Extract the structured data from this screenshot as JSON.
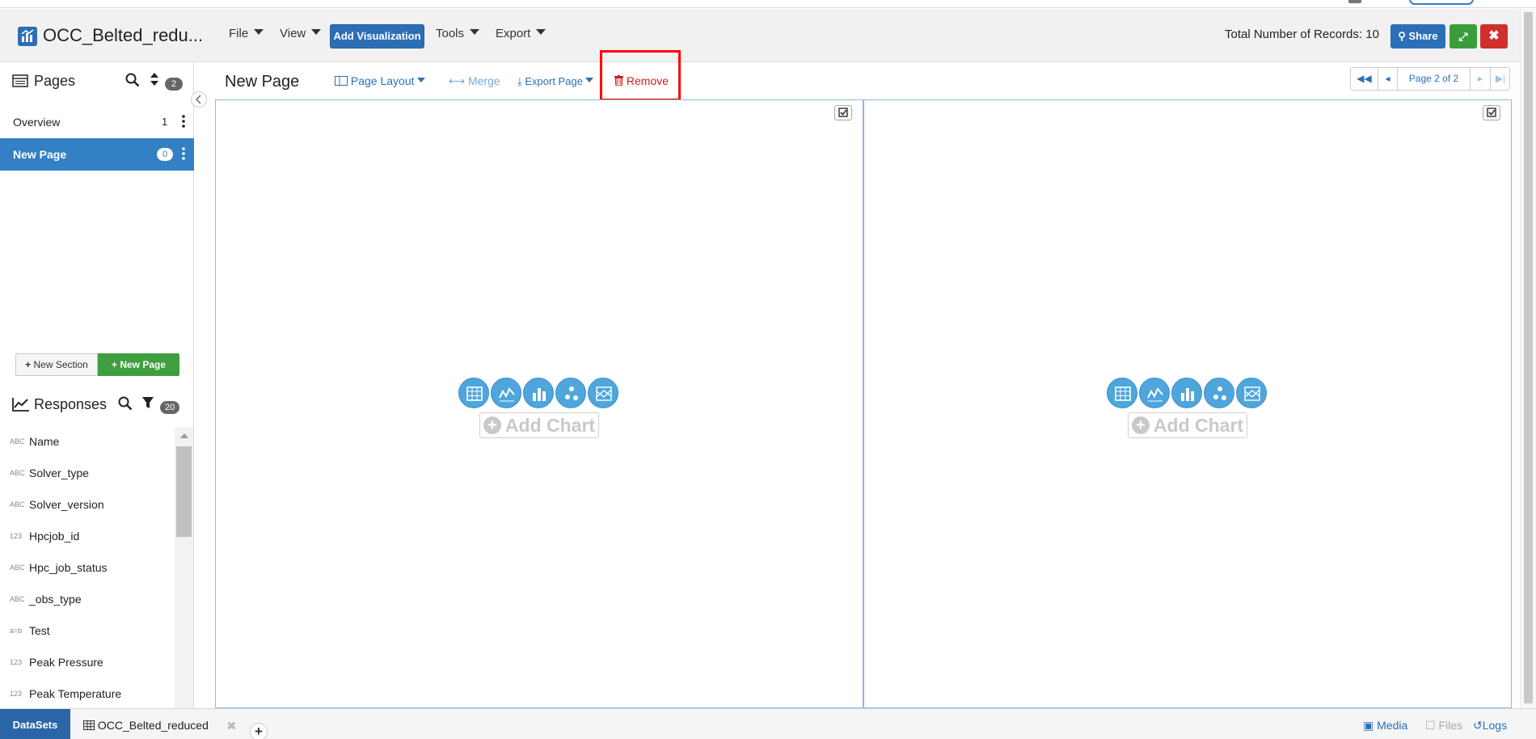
{
  "header": {
    "app_title": "OCC_Belted_redu...",
    "menus": {
      "file": "File",
      "view": "View",
      "tools": "Tools",
      "export": "Export"
    },
    "add_visualization": "Add Visualization",
    "records_label": "Total Number of Records: 10",
    "share": "Share"
  },
  "sidebar": {
    "pages_title": "Pages",
    "pages_count": "2",
    "pages": [
      {
        "label": "Overview",
        "count": "1"
      },
      {
        "label": "New Page",
        "count": "0"
      }
    ],
    "new_section": "New Section",
    "new_page": "New Page",
    "responses_title": "Responses",
    "responses_count": "20",
    "responses": [
      {
        "type": "ABC",
        "name": "Name"
      },
      {
        "type": "ABC",
        "name": "Solver_type"
      },
      {
        "type": "ABC",
        "name": "Solver_version"
      },
      {
        "type": "123",
        "name": "Hpcjob_id"
      },
      {
        "type": "ABC",
        "name": "Hpc_job_status"
      },
      {
        "type": "ABC",
        "name": "_obs_type"
      },
      {
        "type": "a=b",
        "name": "Test"
      },
      {
        "type": "123",
        "name": "Peak Pressure"
      },
      {
        "type": "123",
        "name": "Peak Temperature"
      }
    ]
  },
  "main": {
    "page_title": "New Page",
    "toolbar": {
      "page_layout": "Page Layout",
      "merge": "Merge",
      "export_page": "Export Page",
      "remove": "Remove"
    },
    "pager": {
      "label": "Page 2 of 2"
    },
    "panels": [
      {
        "add_chart": "Add Chart"
      },
      {
        "add_chart": "Add Chart"
      }
    ]
  },
  "bottom": {
    "datasets": "DataSets",
    "dataset_tab": "OCC_Belted_reduced",
    "media": "Media",
    "files": "Files",
    "logs": "Logs"
  },
  "colors": {
    "accent": "#2c6fb7",
    "active_row": "#3480c4",
    "success": "#3f9e3f",
    "danger": "#d12e2e",
    "chart_icon": "#4ea6dc",
    "highlight": "#ff0000"
  }
}
